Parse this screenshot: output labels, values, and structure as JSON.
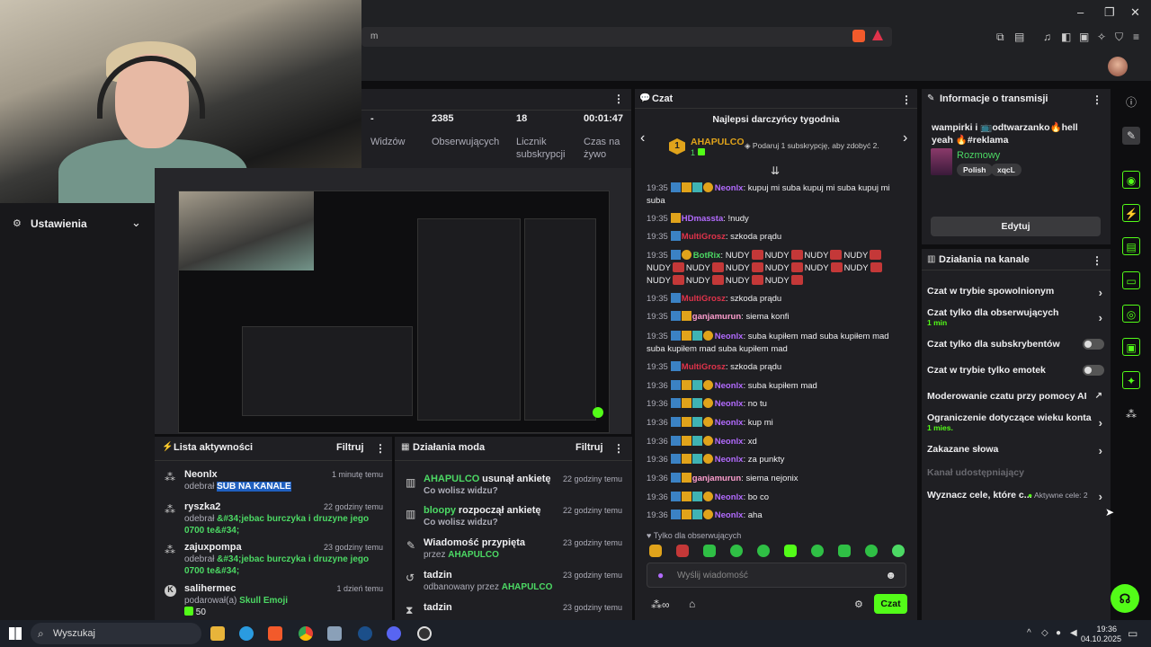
{
  "browser": {
    "url_fragment": "m",
    "window_controls": [
      "–",
      "❐",
      "✕"
    ]
  },
  "left_panel": {
    "settings_label": "Ustawienia"
  },
  "stats": {
    "items": [
      {
        "value": "-",
        "label": "Widzów"
      },
      {
        "value": "2385",
        "label": "Obserwujących"
      },
      {
        "value": "18",
        "label": "Licznik subskrypcji"
      },
      {
        "value": "00:01:47",
        "label": "Czas na żywo"
      }
    ]
  },
  "activity": {
    "title": "Lista aktywności",
    "filter": "Filtruj",
    "items": [
      {
        "name": "Neonlx",
        "time": "1 minutę temu",
        "prefix": "odebrał",
        "detail": "SUB NA KANALE"
      },
      {
        "name": "ryszka2",
        "time": "22 godziny temu",
        "prefix": "odebrał",
        "detail": "&#34;jebac burczyka i druzyne jego 0700 te&#34;"
      },
      {
        "name": "zajuxpompa",
        "time": "23 godziny temu",
        "prefix": "odebrał",
        "detail": "&#34;jebac burczyka i druzyne jego 0700 te&#34;"
      },
      {
        "name": "salihermec",
        "time": "1 dzień temu",
        "prefix": "podarował(a)",
        "detail": "Skull Emoji",
        "extra": "50"
      }
    ]
  },
  "mod_actions": {
    "title": "Działania moda",
    "filter": "Filtruj",
    "items": [
      {
        "name": "AHAPULCO",
        "action": "usunął ankietę",
        "sub": "Co wolisz widzu?",
        "time": "22 godziny temu"
      },
      {
        "name": "bloopy",
        "action": "rozpoczął ankietę",
        "sub": "Co wolisz widzu?",
        "time": "22 godziny temu"
      },
      {
        "name": "Wiadomość przypięta",
        "action": "",
        "sub_prefix": "przez",
        "sub": "AHAPULCO",
        "time": "23 godziny temu"
      },
      {
        "name": "tadzin",
        "action": "",
        "sub_prefix": "odbanowany przez",
        "sub": "AHAPULCO",
        "time": "23 godziny temu"
      },
      {
        "name": "tadzin",
        "action": "",
        "sub": "",
        "time": "23 godziny temu"
      }
    ]
  },
  "chat": {
    "title": "Czat",
    "top_gifters_title": "Najlepsi darczyńcy tygodnia",
    "gifter_name": "AHAPULCO",
    "gifter_count": "1",
    "gifter_rank": "1",
    "gift_hint": "Podaruj 1 subskrypcję, aby zdobyć 2.",
    "messages": [
      {
        "time": "19:35",
        "user": "Neonlx",
        "color": "#b36bff",
        "text": "kupuj mi suba kupuj mi suba kupuj mi suba"
      },
      {
        "time": "19:35",
        "user": "HDmassta",
        "color": "#b36bff",
        "text": "!nudy"
      },
      {
        "time": "19:35",
        "user": "MultiGrosz",
        "color": "#e0334b",
        "text": "szkoda prądu"
      },
      {
        "time": "19:35",
        "user": "BotRix",
        "color": "#4cd964",
        "text": "NUDY"
      },
      {
        "time": "19:35",
        "user": "MultiGrosz",
        "color": "#e0334b",
        "text": "szkoda prądu"
      },
      {
        "time": "19:35",
        "user": "ganjamurun",
        "color": "#ff9ecf",
        "text": "siema konfi"
      },
      {
        "time": "19:35",
        "user": "Neonlx",
        "color": "#b36bff",
        "text": "suba kupiłem mad suba kupiłem mad suba kupiłem mad suba kupiłem mad"
      },
      {
        "time": "19:35",
        "user": "MultiGrosz",
        "color": "#e0334b",
        "text": "szkoda prądu"
      },
      {
        "time": "19:36",
        "user": "Neonlx",
        "color": "#b36bff",
        "text": "suba kupiłem mad"
      },
      {
        "time": "19:36",
        "user": "Neonlx",
        "color": "#b36bff",
        "text": "no tu"
      },
      {
        "time": "19:36",
        "user": "Neonlx",
        "color": "#b36bff",
        "text": "kup mi"
      },
      {
        "time": "19:36",
        "user": "Neonlx",
        "color": "#b36bff",
        "text": "xd"
      },
      {
        "time": "19:36",
        "user": "Neonlx",
        "color": "#b36bff",
        "text": "za punkty"
      },
      {
        "time": "19:36",
        "user": "ganjamurun",
        "color": "#ff9ecf",
        "text": "siema nejonix"
      },
      {
        "time": "19:36",
        "user": "Neonlx",
        "color": "#b36bff",
        "text": "bo co"
      },
      {
        "time": "19:36",
        "user": "Neonlx",
        "color": "#b36bff",
        "text": "aha"
      }
    ],
    "followers_only": "Tylko dla obserwujących",
    "input_placeholder": "Wyślij wiadomość",
    "send": "Czat"
  },
  "stream_info": {
    "title": "Informacje o transmisji",
    "description": "wampirki i 📺odtwarzanko🔥hell yeah 🔥#reklama",
    "category": "Rozmowy",
    "tags": [
      "Polish",
      "xqcL"
    ],
    "edit": "Edytuj"
  },
  "channel_actions": {
    "title": "Działania na kanale",
    "items": [
      {
        "label": "Czat w trybie spowolnionym",
        "kind": "chevron"
      },
      {
        "label": "Czat tylko dla obserwujących",
        "sub": "1 min",
        "kind": "chevron"
      },
      {
        "label": "Czat tylko dla subskrybentów",
        "kind": "toggle"
      },
      {
        "label": "Czat w trybie tylko emotek",
        "kind": "toggle"
      },
      {
        "label": "Moderowanie czatu przy pomocy AI",
        "kind": "link"
      },
      {
        "label": "Ograniczenie dotyczące wieku konta",
        "sub": "1 mies.",
        "kind": "chevron"
      },
      {
        "label": "Zakazane słowa",
        "kind": "chevron"
      },
      {
        "label": "Kanał udostępniający",
        "kind": "disabled"
      },
      {
        "label": "Wyznacz cele, które c...",
        "status": "Aktywne cele: 2",
        "kind": "chevron"
      }
    ]
  },
  "taskbar": {
    "search": "Wyszukaj",
    "time": "19:36",
    "date": "04.10.2025"
  },
  "colors": {
    "accent_green": "#53fc18",
    "purple": "#b36bff",
    "panel": "#1f1f23"
  }
}
